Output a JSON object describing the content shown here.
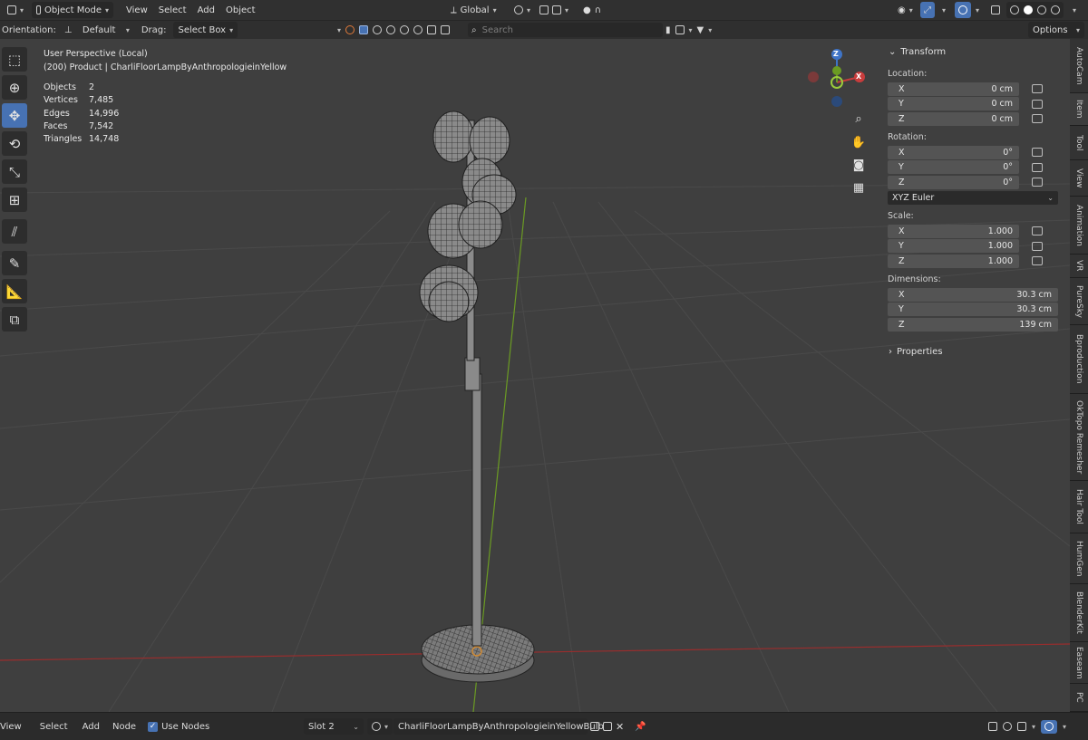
{
  "topbar": {
    "mode": "Object Mode",
    "menus": [
      "View",
      "Select",
      "Add",
      "Object"
    ],
    "transform_orientation": "Global"
  },
  "toolheader": {
    "orientation_label": "Orientation:",
    "orientation_value": "Default",
    "drag_label": "Drag:",
    "drag_value": "Select Box",
    "search_placeholder": "Search",
    "options": "Options"
  },
  "overlay": {
    "view_name": "User Perspective (Local)",
    "object_name": "(200) Product | CharliFloorLampByAnthropologieinYellow",
    "stats": [
      {
        "label": "Objects",
        "value": "2"
      },
      {
        "label": "Vertices",
        "value": "7,485"
      },
      {
        "label": "Edges",
        "value": "14,996"
      },
      {
        "label": "Faces",
        "value": "7,542"
      },
      {
        "label": "Triangles",
        "value": "14,748"
      }
    ]
  },
  "gizmo": {
    "z": "Z",
    "x": "X"
  },
  "npanel": {
    "transform_title": "Transform",
    "location_label": "Location:",
    "location": [
      {
        "axis": "X",
        "value": "0 cm"
      },
      {
        "axis": "Y",
        "value": "0 cm"
      },
      {
        "axis": "Z",
        "value": "0 cm"
      }
    ],
    "rotation_label": "Rotation:",
    "rotation": [
      {
        "axis": "X",
        "value": "0°"
      },
      {
        "axis": "Y",
        "value": "0°"
      },
      {
        "axis": "Z",
        "value": "0°"
      }
    ],
    "rotation_mode": "XYZ Euler",
    "scale_label": "Scale:",
    "scale": [
      {
        "axis": "X",
        "value": "1.000"
      },
      {
        "axis": "Y",
        "value": "1.000"
      },
      {
        "axis": "Z",
        "value": "1.000"
      }
    ],
    "dimensions_label": "Dimensions:",
    "dimensions": [
      {
        "axis": "X",
        "value": "30.3 cm"
      },
      {
        "axis": "Y",
        "value": "30.3 cm"
      },
      {
        "axis": "Z",
        "value": "139 cm"
      }
    ],
    "properties_title": "Properties"
  },
  "sidetabs": [
    "AutoCam",
    "Item",
    "Tool",
    "View",
    "Animation",
    "VR",
    "PureSky",
    "Bproduction",
    "OkTopo Remesher",
    "Hair Tool",
    "HumGen",
    "BlenderKit",
    "Easeam",
    "PC"
  ],
  "bottombar": {
    "menus": [
      "View",
      "Select",
      "Add",
      "Node"
    ],
    "use_nodes": "Use Nodes",
    "slot": "Slot 2",
    "material": "CharliFloorLampByAnthropologieinYellowBulb"
  },
  "colors": {
    "accent": "#4772b3",
    "x_axis": "#c83c3c",
    "y_axis": "#6b9b23",
    "z_axis": "#3f74c7"
  }
}
